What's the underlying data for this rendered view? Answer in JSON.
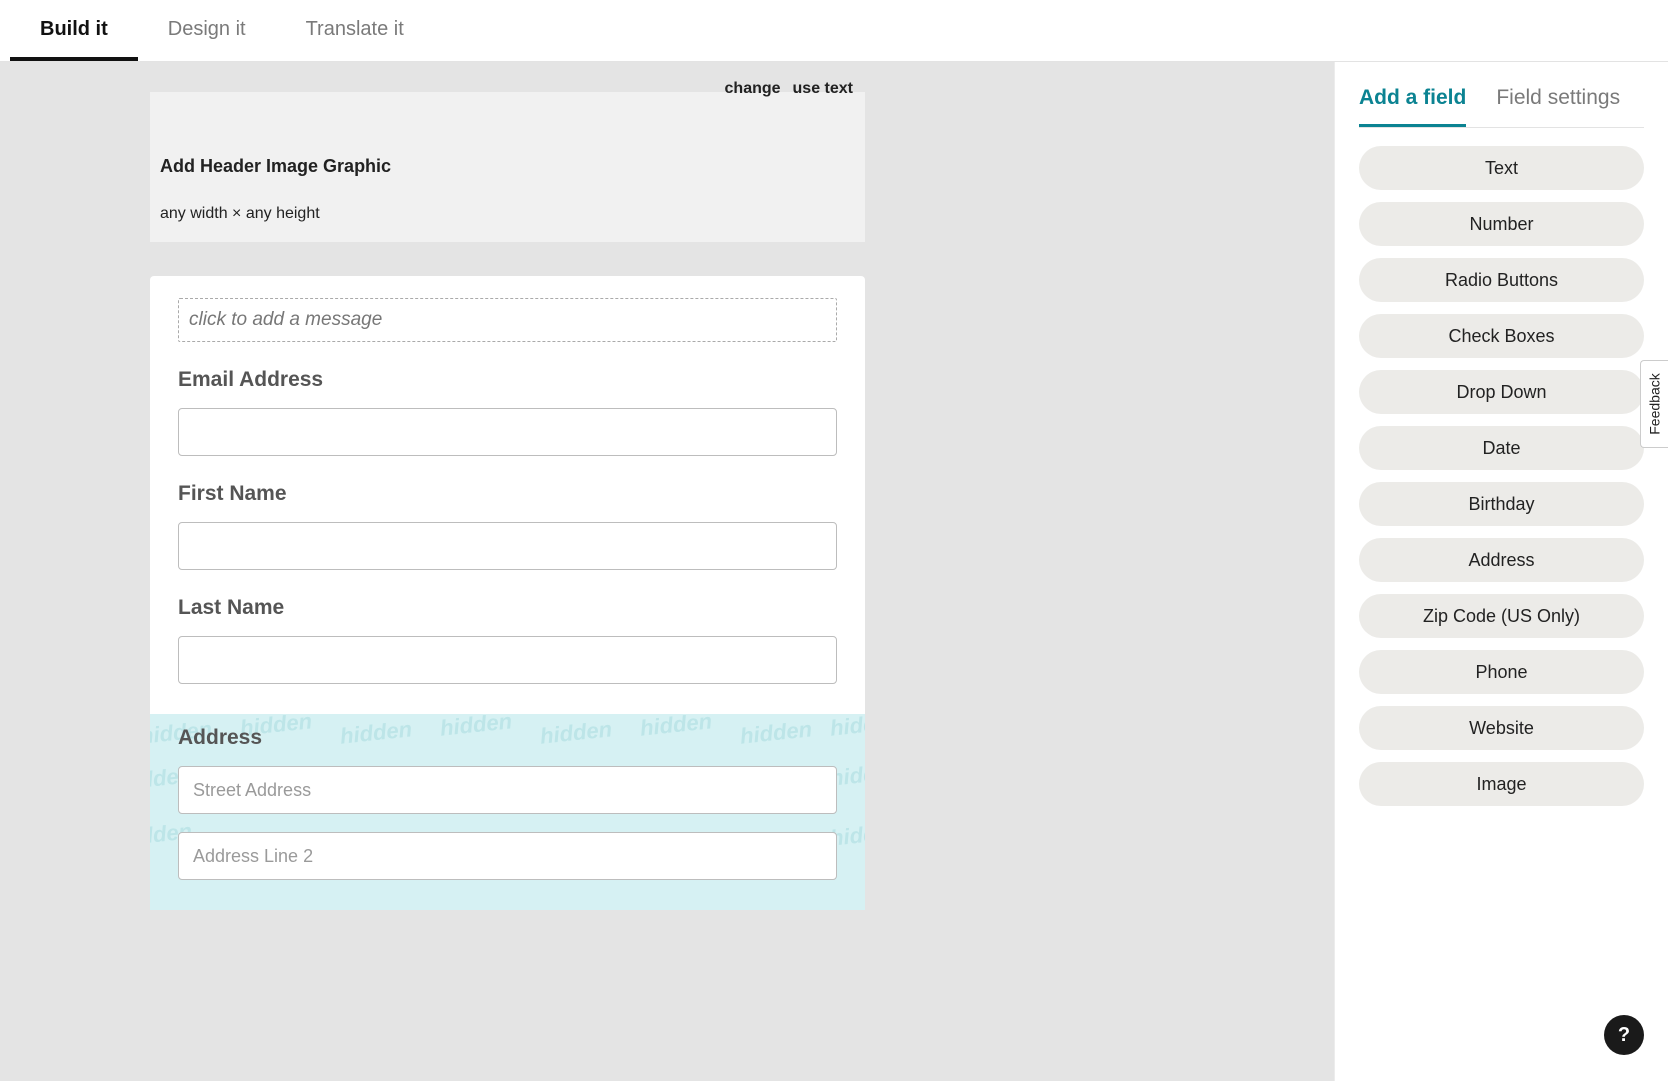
{
  "top_tabs": {
    "build": "Build it",
    "design": "Design it",
    "translate": "Translate it"
  },
  "header_image": {
    "change": "change",
    "use_text": "use text",
    "title": "Add Header Image Graphic",
    "subtitle": "any width × any height"
  },
  "form": {
    "message_placeholder": "click to add a message",
    "email_label": "Email Address",
    "first_name_label": "First Name",
    "last_name_label": "Last Name",
    "address_label": "Address",
    "street_placeholder": "Street Address",
    "line2_placeholder": "Address Line 2",
    "hidden_word": "hidden"
  },
  "sidebar": {
    "tabs": {
      "add": "Add a field",
      "settings": "Field settings"
    },
    "buttons": [
      "Text",
      "Number",
      "Radio Buttons",
      "Check Boxes",
      "Drop Down",
      "Date",
      "Birthday",
      "Address",
      "Zip Code (US Only)",
      "Phone",
      "Website",
      "Image"
    ]
  },
  "feedback_label": "Feedback",
  "help_label": "?"
}
